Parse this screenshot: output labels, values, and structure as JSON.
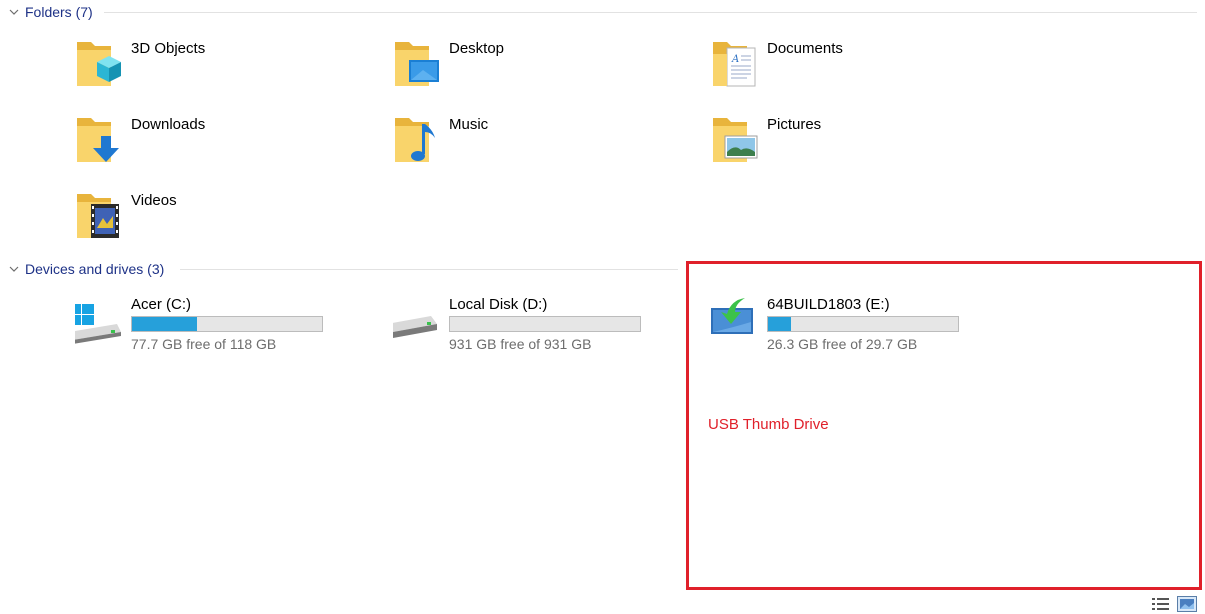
{
  "folders_section": {
    "title": "Folders (7)",
    "items": [
      {
        "label": "3D Objects",
        "icon": "3d-objects-folder-icon"
      },
      {
        "label": "Desktop",
        "icon": "desktop-folder-icon"
      },
      {
        "label": "Documents",
        "icon": "documents-folder-icon"
      },
      {
        "label": "Downloads",
        "icon": "downloads-folder-icon"
      },
      {
        "label": "Music",
        "icon": "music-folder-icon"
      },
      {
        "label": "Pictures",
        "icon": "pictures-folder-icon"
      },
      {
        "label": "Videos",
        "icon": "videos-folder-icon"
      }
    ]
  },
  "drives_section": {
    "title": "Devices and drives (3)",
    "items": [
      {
        "label": "Acer (C:)",
        "free": "77.7 GB free of 118 GB",
        "used_fraction": 0.34,
        "icon": "windows-drive-icon"
      },
      {
        "label": "Local Disk (D:)",
        "free": "931 GB free of 931 GB",
        "used_fraction": 0.0,
        "icon": "hard-drive-icon"
      },
      {
        "label": "64BUILD1803 (E:)",
        "free": "26.3 GB free of 29.7 GB",
        "used_fraction": 0.12,
        "icon": "removable-drive-icon"
      }
    ]
  },
  "annotation": {
    "text": "USB Thumb Drive",
    "color": "#e0202a"
  },
  "view_buttons": {
    "details_icon": "details-view-icon",
    "tiles_icon": "large-icons-view-icon"
  },
  "colors": {
    "header_text": "#1e3287",
    "bar_fill": "#26a0da",
    "bar_bg": "#e6e6e6",
    "free_text": "#6d6d6d"
  }
}
